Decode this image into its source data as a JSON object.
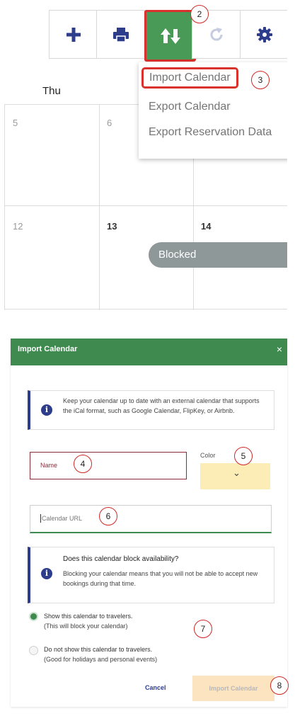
{
  "toolbar": {
    "add_icon": "plus-icon",
    "print_icon": "printer-icon",
    "import_export_icon": "import-export-arrows-icon",
    "refresh_icon": "refresh-icon",
    "settings_icon": "gear-icon",
    "active_color": "#4a9a57"
  },
  "calendar": {
    "day_header": "Thu",
    "row1": [
      "5",
      "6"
    ],
    "row2": [
      "12",
      "13",
      "14"
    ],
    "blocked_label": "Blocked"
  },
  "dropdown": {
    "items": [
      "Import Calendar",
      "Export Calendar",
      "Export Reservation Data"
    ]
  },
  "callouts": {
    "c2": "2",
    "c3": "3",
    "c4": "4",
    "c5": "5",
    "c6": "6",
    "c7": "7",
    "c8": "8"
  },
  "dialog": {
    "title": "Import Calendar",
    "close": "×",
    "info1": "Keep your calendar up to date with an external calendar that supports the iCal format, such as Google Calendar, FlipKey, or Airbnb.",
    "name_placeholder": "Name",
    "color_label": "Color",
    "color_chevron": "⌄",
    "url_placeholder": "Calendar URL",
    "info2_title": "Does this calendar block availability?",
    "info2_text": "Blocking your calendar means that you will not be able to accept new bookings during that time.",
    "radio1_label": "Show this calendar to travelers.",
    "radio1_sub": "(This will block your calendar)",
    "radio2_label": "Do not show this calendar to travelers.",
    "radio2_sub": "(Good for holidays and personal events)",
    "cancel": "Cancel",
    "import": "Import Calendar",
    "accent": "#3f8a4f",
    "info_color": "#2d3d8c"
  }
}
